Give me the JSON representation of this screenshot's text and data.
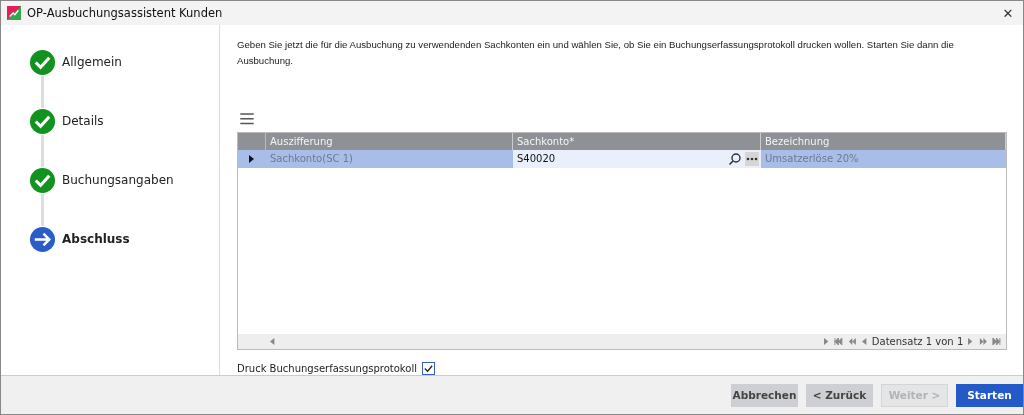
{
  "window": {
    "title": "OP-Ausbuchungsassistent Kunden",
    "close": "✕"
  },
  "steps": [
    {
      "label": "Allgemein",
      "kind": "done"
    },
    {
      "label": "Details",
      "kind": "done"
    },
    {
      "label": "Buchungsangaben",
      "kind": "done"
    },
    {
      "label": "Abschluss",
      "kind": "current"
    }
  ],
  "instruction": "Geben Sie jetzt die für die Ausbuchung zu verwendenden Sachkonten ein und wählen Sie, ob Sie ein Buchungserfassungsprotokoll drucken wollen. Starten Sie dann die Ausbuchung.",
  "table": {
    "columns": [
      "Auszifferung",
      "Sachkonto*",
      "Bezeichnung"
    ],
    "rows": [
      {
        "selected": true,
        "cells": [
          "Sachkonto(SC 1)",
          "S40020",
          "Umsatzerlöse 20%"
        ]
      }
    ],
    "record": "Datensatz 1 von 1"
  },
  "print_option": {
    "label": "Druck Buchungserfassungsprotokoll",
    "checked": true
  },
  "buttons": [
    {
      "label": "Abbrechen",
      "kind": "secondary",
      "disabled": false
    },
    {
      "label": "< Zurück",
      "kind": "secondary",
      "disabled": false
    },
    {
      "label": "Weiter >",
      "kind": "secondary",
      "disabled": true
    },
    {
      "label": "Starten",
      "kind": "primary",
      "disabled": false
    }
  ]
}
